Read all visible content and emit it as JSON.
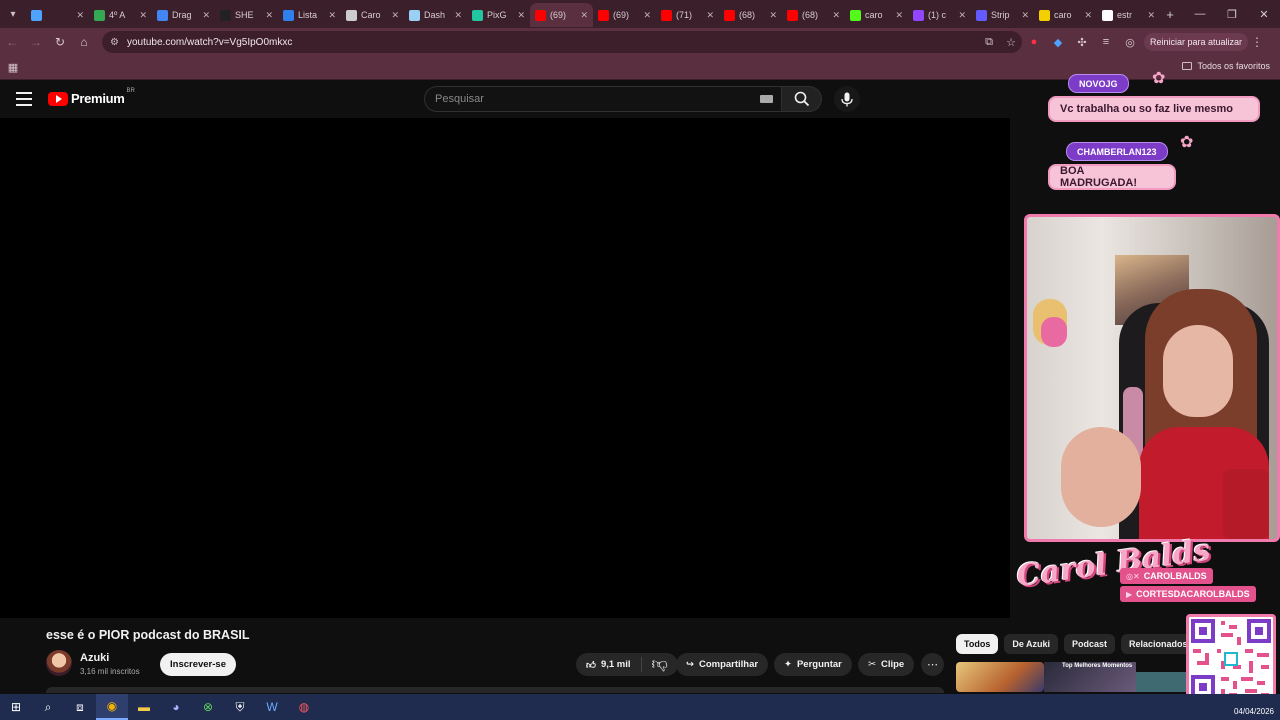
{
  "browser": {
    "tabs": [
      {
        "label": "",
        "color": "#4da3ff",
        "active": false
      },
      {
        "label": "4º A",
        "color": "#34a853",
        "active": false
      },
      {
        "label": "Drag",
        "color": "#4285f4",
        "active": false
      },
      {
        "label": "SHE",
        "color": "#222222",
        "active": false
      },
      {
        "label": "Lista",
        "color": "#2f80ed",
        "active": false
      },
      {
        "label": "Caro",
        "color": "#cccccc",
        "active": false
      },
      {
        "label": "Dash",
        "color": "#9ad0f5",
        "active": false
      },
      {
        "label": "PixG",
        "color": "#20c7a0",
        "active": false
      },
      {
        "label": "(69)",
        "color": "#ff0000",
        "active": true
      },
      {
        "label": "(69)",
        "color": "#ff0000",
        "active": false
      },
      {
        "label": "(71)",
        "color": "#ff0000",
        "active": false
      },
      {
        "label": "(68)",
        "color": "#ff0000",
        "active": false
      },
      {
        "label": "(68)",
        "color": "#ff0000",
        "active": false
      },
      {
        "label": "caro",
        "color": "#53fc18",
        "active": false
      },
      {
        "label": "(1) c",
        "color": "#9146ff",
        "active": false
      },
      {
        "label": "Strip",
        "color": "#635bff",
        "active": false
      },
      {
        "label": "caro",
        "color": "#f5d000",
        "active": false
      },
      {
        "label": "estr",
        "color": "#ffffff",
        "active": false
      }
    ],
    "url": "youtube.com/watch?v=Vg5IpO0mkxc",
    "relaunch_label": "Reiniciar para atualizar",
    "all_favorites": "Todos os favoritos"
  },
  "youtube": {
    "brand": "Premium",
    "region": "BR",
    "search_placeholder": "Pesquisar",
    "video_title": "esse é o PIOR podcast do BRASIL",
    "channel_name": "Azuki",
    "subscribers": "3,16 mil inscritos",
    "subscribe_label": "Inscrever-se",
    "likes": "9,1 mil",
    "share_label": "Compartilhar",
    "ask_label": "Perguntar",
    "clip_label": "Clipe",
    "chips": [
      "Todos",
      "De Azuki",
      "Podcast",
      "Relacionados"
    ],
    "thumb_text": "Top Melhores Momentos"
  },
  "overlay": {
    "chat": [
      {
        "user": "NOVOJG",
        "message": "Vc trabalha ou so faz live mesmo"
      },
      {
        "user": "CHAMBERLAN123",
        "message": "BOA MADRUGADA!"
      }
    ],
    "brand_logo": "Carol Balds",
    "handles": [
      "CAROLBALDS",
      "CORTESDACAROLBALDS"
    ],
    "accent": "#f07aab"
  },
  "taskbar": {
    "date": "04/04/2026"
  }
}
